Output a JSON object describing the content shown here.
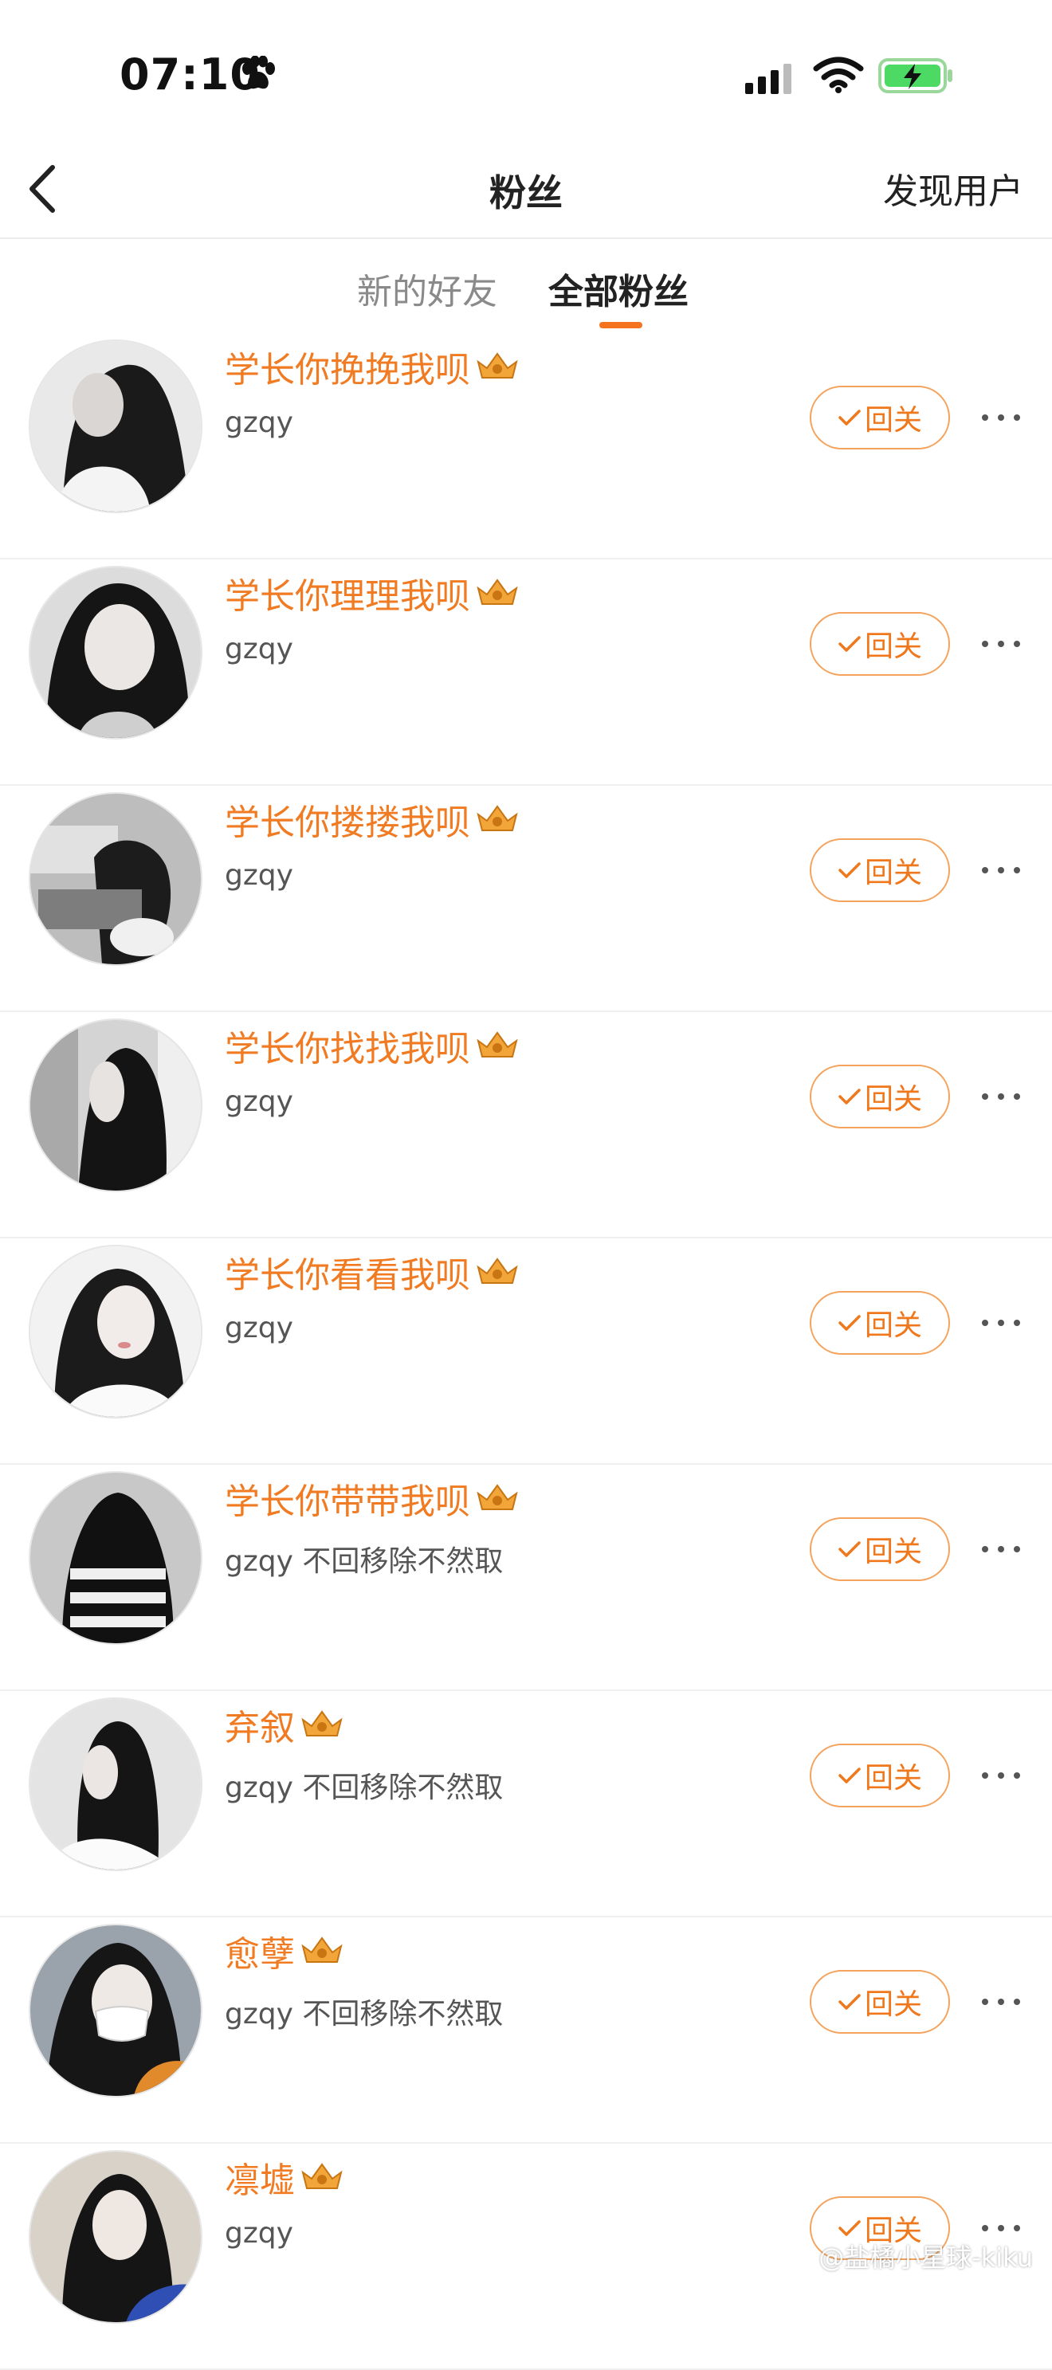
{
  "status_bar": {
    "time": "07:10"
  },
  "nav": {
    "title": "粉丝",
    "right_action": "发现用户"
  },
  "tabs": [
    {
      "label": "新的好友"
    },
    {
      "label": "全部粉丝"
    }
  ],
  "active_tab": 1,
  "colors": {
    "accent": "#f5731f",
    "nickname": "#f07b22",
    "battery": "#4cd964"
  },
  "fans": [
    {
      "nickname": "学长你挽挽我呗",
      "desc": "gzqy",
      "button": "回关"
    },
    {
      "nickname": "学长你理理我呗",
      "desc": "gzqy",
      "button": "回关"
    },
    {
      "nickname": "学长你搂搂我呗",
      "desc": "gzqy",
      "button": "回关"
    },
    {
      "nickname": "学长你找找我呗",
      "desc": "gzqy",
      "button": "回关"
    },
    {
      "nickname": "学长你看看我呗",
      "desc": "gzqy",
      "button": "回关"
    },
    {
      "nickname": "学长你带带我呗",
      "desc": "gzqy 不回移除不然取",
      "button": "回关"
    },
    {
      "nickname": "弃叙",
      "desc": "gzqy 不回移除不然取",
      "button": "回关"
    },
    {
      "nickname": "愈孽",
      "desc": "gzqy 不回移除不然取",
      "button": "回关"
    },
    {
      "nickname": "凛墟",
      "desc": "gzqy",
      "button": "回关"
    }
  ],
  "watermark": "@盐橘小星球-kiku",
  "icons": [
    "paw-icon",
    "signal-icon",
    "wifi-icon",
    "battery-icon",
    "back-icon",
    "crown-icon",
    "checkmark-icon",
    "more-icon",
    "weibo-icon"
  ]
}
